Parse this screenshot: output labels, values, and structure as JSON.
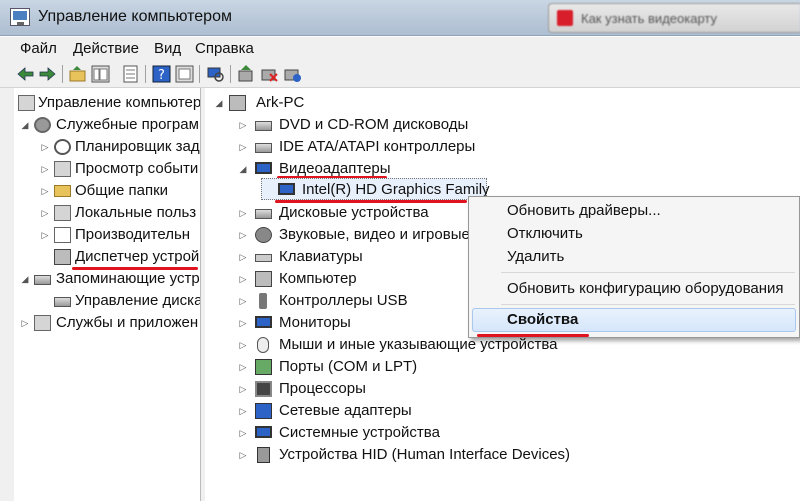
{
  "window": {
    "title": "Управление компьютером"
  },
  "background_tab": {
    "title": "Как узнать видеокарту"
  },
  "menu": [
    "Файл",
    "Действие",
    "Вид",
    "Справка"
  ],
  "toolbar_icons": [
    "back-arrow-icon",
    "forward-arrow-icon",
    "up-folder-icon",
    "show-tree-icon",
    "properties-icon",
    "help-icon",
    "show-hide-icon",
    "scan-hardware-icon",
    "update-driver-icon",
    "disable-device-icon",
    "uninstall-device-icon"
  ],
  "left_tree": [
    {
      "label": "Управление компьютер",
      "icon": "computer-management-icon"
    },
    {
      "label": "Служебные програм",
      "icon": "tools-icon"
    },
    {
      "label": "Планировщик зад",
      "icon": "clock-icon"
    },
    {
      "label": "Просмотр событи",
      "icon": "event-viewer-icon"
    },
    {
      "label": "Общие папки",
      "icon": "shared-folder-icon"
    },
    {
      "label": "Локальные польз",
      "icon": "users-icon"
    },
    {
      "label": "Производительн",
      "icon": "performance-icon"
    },
    {
      "label": "Диспетчер устрой",
      "icon": "device-manager-icon"
    },
    {
      "label": "Запоминающие устр",
      "icon": "storage-icon"
    },
    {
      "label": "Управление диска",
      "icon": "disk-management-icon"
    },
    {
      "label": "Службы и приложен",
      "icon": "services-icon"
    }
  ],
  "device_tree": {
    "root": "Ark-PC",
    "categories": [
      {
        "label": "DVD и CD-ROM дисководы",
        "icon": "dvd-drive-icon"
      },
      {
        "label": "IDE ATA/ATAPI контроллеры",
        "icon": "ide-controller-icon"
      },
      {
        "label": "Видеоадаптеры",
        "icon": "display-adapter-icon"
      },
      {
        "label": "Intel(R) HD Graphics Family",
        "icon": "display-adapter-icon"
      },
      {
        "label": "Дисковые устройства",
        "icon": "disk-drive-icon"
      },
      {
        "label": "Звуковые, видео и игровые",
        "icon": "sound-icon"
      },
      {
        "label": "Клавиатуры",
        "icon": "keyboard-icon"
      },
      {
        "label": "Компьютер",
        "icon": "computer-icon"
      },
      {
        "label": "Контроллеры USB",
        "icon": "usb-icon"
      },
      {
        "label": "Мониторы",
        "icon": "monitor-icon"
      },
      {
        "label": "Мыши и иные указывающие устройства",
        "icon": "mouse-icon"
      },
      {
        "label": "Порты (COM и LPT)",
        "icon": "port-icon"
      },
      {
        "label": "Процессоры",
        "icon": "processor-icon"
      },
      {
        "label": "Сетевые адаптеры",
        "icon": "network-adapter-icon"
      },
      {
        "label": "Системные устройства",
        "icon": "system-device-icon"
      },
      {
        "label": "Устройства HID (Human Interface Devices)",
        "icon": "hid-icon"
      }
    ]
  },
  "context_menu": {
    "items": [
      "Обновить драйверы...",
      "Отключить",
      "Удалить",
      "Обновить конфигурацию оборудования",
      "Свойства"
    ],
    "highlighted": "Свойства"
  },
  "colors": {
    "annotation_red": "#e0141e",
    "titlebar": "#b8c7d8",
    "highlight": "#d6e6fb"
  }
}
